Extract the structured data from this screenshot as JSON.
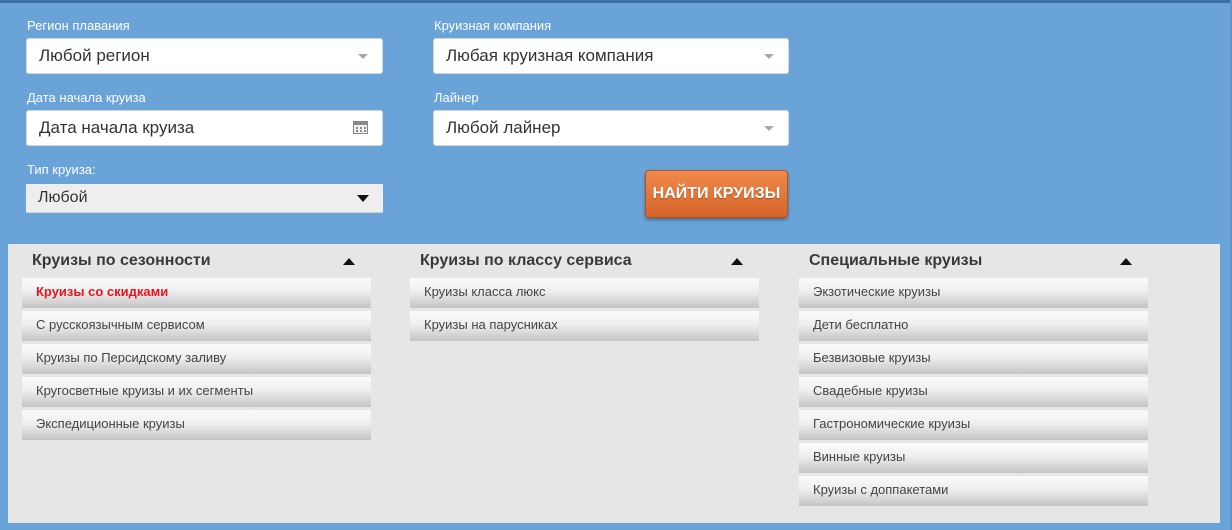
{
  "search_form": {
    "region": {
      "label": "Регион плавания",
      "value": "Любой регион"
    },
    "company": {
      "label": "Круизная компания",
      "value": "Любая круизная компания"
    },
    "start_date": {
      "label": "Дата начала круиза",
      "placeholder": "Дата начала круиза"
    },
    "liner": {
      "label": "Лайнер",
      "value": "Любой лайнер"
    },
    "cruise_type": {
      "label": "Тип круиза:",
      "value": "Любой"
    },
    "search_button": "НАЙТИ КРУИЗЫ",
    "button_color": "#e0763a"
  },
  "categories": {
    "seasonal": {
      "title": "Круизы по сезонности",
      "items": [
        "Круизы со скидками",
        "С русскоязычным сервисом",
        "Круизы по Персидскому заливу",
        "Кругосветные круизы и их сегменты",
        "Экспедиционные круизы"
      ]
    },
    "service_class": {
      "title": "Круизы по классу сервиса",
      "items": [
        "Круизы класса люкс",
        "Круизы на парусниках"
      ]
    },
    "special": {
      "title": "Специальные круизы",
      "items": [
        "Экзотические круизы",
        "Дети бесплатно",
        "Безвизовые круизы",
        "Свадебные круизы",
        "Гастрономические круизы",
        "Винные круизы",
        "Круизы с доппакетами"
      ]
    }
  },
  "colors": {
    "panel_background": "#6aa3d8",
    "categories_background": "#e6e6e6",
    "highlight_text": "#e8141d"
  }
}
